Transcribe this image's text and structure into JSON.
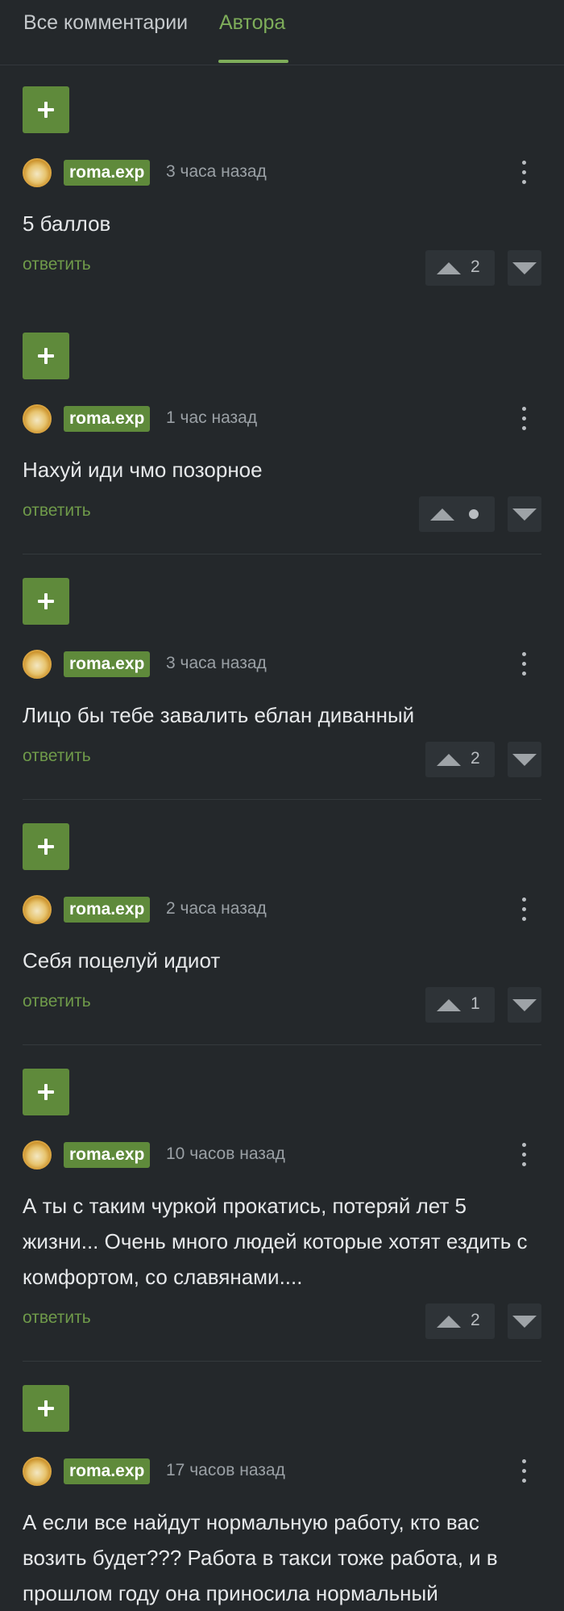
{
  "tabs": {
    "all": "Все комментарии",
    "author": "Автора"
  },
  "reply_label": "ответить",
  "comments": [
    {
      "username": "roma.exp",
      "time": "3 часа назад",
      "text": "5 баллов",
      "votes": "2"
    },
    {
      "username": "roma.exp",
      "time": "1 час назад",
      "text": "Нахуй иди чмо позорное",
      "votes": ""
    },
    {
      "username": "roma.exp",
      "time": "3 часа назад",
      "text": "Лицо бы тебе завалить еблан диванный",
      "votes": "2"
    },
    {
      "username": "roma.exp",
      "time": "2 часа назад",
      "text": "Себя поцелуй идиот",
      "votes": "1"
    },
    {
      "username": "roma.exp",
      "time": "10 часов назад",
      "text": "А ты с таким чуркой прокатись, потеряй лет 5 жизни... Очень много людей которые хотят ездить с комфортом, со славянами....",
      "votes": "2"
    },
    {
      "username": "roma.exp",
      "time": "17 часов назад",
      "text": "А если все найдут нормальную работу, кто вас возить будет??? Работа в такси тоже работа, и в прошлом году она приносила нормальный",
      "votes": ""
    }
  ],
  "colors": {
    "background": "#24282b",
    "accent": "#5f8a3b",
    "link": "#6f9a4a"
  }
}
